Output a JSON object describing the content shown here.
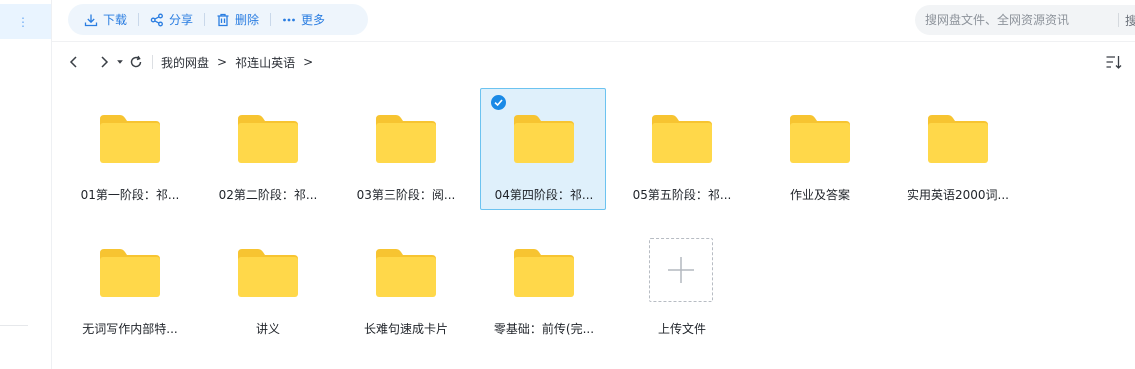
{
  "toolbar": {
    "download_label": "下载",
    "share_label": "分享",
    "delete_label": "删除",
    "more_label": "更多"
  },
  "search": {
    "placeholder": "搜网盘文件、全网资源资讯",
    "button_label": "搜"
  },
  "breadcrumb": {
    "root": "我的网盘",
    "separator": ">",
    "current": "祁连山英语",
    "trailing": ">"
  },
  "files": [
    {
      "name": "01第一阶段：祁...",
      "type": "folder",
      "selected": false
    },
    {
      "name": "02第二阶段：祁...",
      "type": "folder",
      "selected": false
    },
    {
      "name": "03第三阶段：阅...",
      "type": "folder",
      "selected": false
    },
    {
      "name": "04第四阶段：祁...",
      "type": "folder",
      "selected": true
    },
    {
      "name": "05第五阶段：祁...",
      "type": "folder",
      "selected": false
    },
    {
      "name": "作业及答案",
      "type": "folder",
      "selected": false
    },
    {
      "name": "实用英语2000词...",
      "type": "folder",
      "selected": false
    },
    {
      "name": "无词写作内部特...",
      "type": "folder",
      "selected": false
    },
    {
      "name": "讲义",
      "type": "folder",
      "selected": false
    },
    {
      "name": "长难句速成卡片",
      "type": "folder",
      "selected": false
    },
    {
      "name": "零基础：前传(完...",
      "type": "folder",
      "selected": false
    }
  ],
  "upload": {
    "label": "上传文件"
  },
  "colors": {
    "accent": "#2a7de1",
    "folder": "#ffd84a",
    "folder_tab": "#f7c431",
    "selected_bg": "#dff0fb",
    "selected_border": "#6cc3f0"
  }
}
